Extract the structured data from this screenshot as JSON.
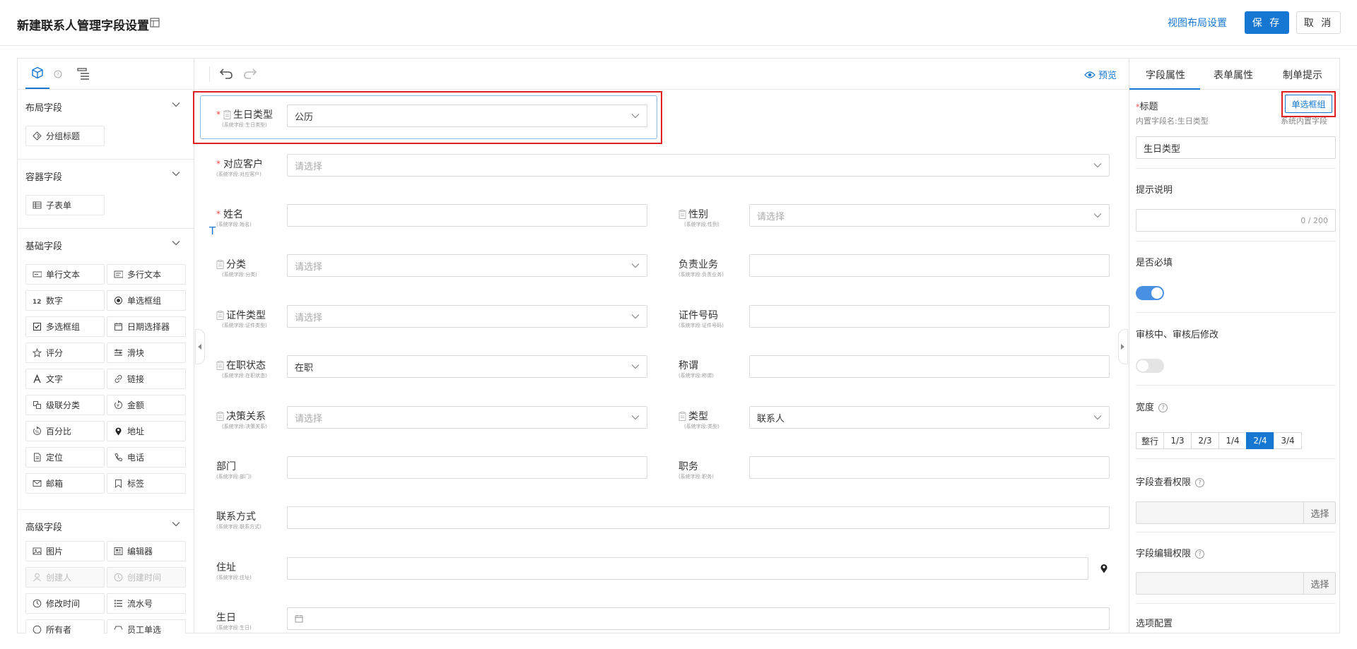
{
  "header": {
    "title": "新建联系人管理字段设置",
    "view_layout": "视图布局设置",
    "save": "保 存",
    "cancel": "取 消"
  },
  "left_panel": {
    "sections": [
      {
        "title": "布局字段",
        "items": [
          {
            "label": "分组标题",
            "icon": "group-title-icon"
          }
        ]
      },
      {
        "title": "容器字段",
        "items": [
          {
            "label": "子表单",
            "icon": "table-icon"
          }
        ]
      },
      {
        "title": "基础字段",
        "items": [
          {
            "label": "单行文本",
            "icon": "single-line-icon"
          },
          {
            "label": "多行文本",
            "icon": "multi-line-icon"
          },
          {
            "label": "数字",
            "icon": "number-icon"
          },
          {
            "label": "单选框组",
            "icon": "radio-icon"
          },
          {
            "label": "多选框组",
            "icon": "checkbox-icon"
          },
          {
            "label": "日期选择器",
            "icon": "calendar-icon"
          },
          {
            "label": "评分",
            "icon": "star-icon"
          },
          {
            "label": "滑块",
            "icon": "slider-icon"
          },
          {
            "label": "文字",
            "icon": "text-icon"
          },
          {
            "label": "链接",
            "icon": "link-icon"
          },
          {
            "label": "级联分类",
            "icon": "cascade-icon"
          },
          {
            "label": "金额",
            "icon": "money-icon"
          },
          {
            "label": "百分比",
            "icon": "percent-icon"
          },
          {
            "label": "地址",
            "icon": "location-icon"
          },
          {
            "label": "定位",
            "icon": "document-icon"
          },
          {
            "label": "电话",
            "icon": "phone-icon"
          },
          {
            "label": "邮箱",
            "icon": "mail-icon"
          },
          {
            "label": "标签",
            "icon": "tag-icon"
          }
        ]
      },
      {
        "title": "高级字段",
        "items": [
          {
            "label": "图片",
            "icon": "image-icon",
            "disabled": false
          },
          {
            "label": "编辑器",
            "icon": "editor-icon",
            "disabled": false
          },
          {
            "label": "创建人",
            "icon": "user-icon",
            "disabled": true
          },
          {
            "label": "创建时间",
            "icon": "clock-icon",
            "disabled": true
          },
          {
            "label": "修改时间",
            "icon": "clock-icon",
            "disabled": false
          },
          {
            "label": "流水号",
            "icon": "serial-icon",
            "disabled": false
          },
          {
            "label": "所有者",
            "icon": "owner-icon",
            "disabled": false
          },
          {
            "label": "员工单选",
            "icon": "employee-icon",
            "disabled": false
          }
        ]
      }
    ]
  },
  "canvas": {
    "preview": "预览",
    "fields": {
      "birthday_type": {
        "label": "生日类型",
        "sub": "(系统字段:生日类型)",
        "value": "公历"
      },
      "customer": {
        "label": "对应客户",
        "sub": "(系统字段:对应客户)",
        "placeholder": "请选择"
      },
      "name": {
        "label": "姓名",
        "sub": "(系统字段:姓名)"
      },
      "gender": {
        "label": "性别",
        "sub": "(系统字段:性别)",
        "placeholder": "请选择"
      },
      "category": {
        "label": "分类",
        "sub": "(系统字段:分类)",
        "placeholder": "请选择"
      },
      "business": {
        "label": "负责业务",
        "sub": "(系统字段:负责业务)"
      },
      "id_type": {
        "label": "证件类型",
        "sub": "(系统字段:证件类型)",
        "placeholder": "请选择"
      },
      "id_number": {
        "label": "证件号码",
        "sub": "(系统字段:证件号码)"
      },
      "status": {
        "label": "在职状态",
        "sub": "(系统字段:在职状态)",
        "value": "在职"
      },
      "title": {
        "label": "称谓",
        "sub": "(系统字段:称谓)"
      },
      "decision": {
        "label": "决策关系",
        "sub": "(系统字段:决策关系)",
        "placeholder": "请选择"
      },
      "type": {
        "label": "类型",
        "sub": "(系统字段:类型)",
        "value": "联系人"
      },
      "dept": {
        "label": "部门",
        "sub": "(系统字段:部门)"
      },
      "position": {
        "label": "职务",
        "sub": "(系统字段:职务)"
      },
      "contact": {
        "label": "联系方式",
        "sub": "(系统字段:联系方式)"
      },
      "address": {
        "label": "住址",
        "sub": "(系统字段:住址)"
      },
      "birthday": {
        "label": "生日",
        "sub": "(系统字段:生日)"
      }
    },
    "text_marker": "T"
  },
  "right_panel": {
    "tabs": [
      "字段属性",
      "表单属性",
      "制单提示"
    ],
    "active_tab": 0,
    "title_label": "标题",
    "badge": "单选框组",
    "builtin_name": "内置字段名:生日类型",
    "system_builtin": "系统内置字段",
    "title_value": "生日类型",
    "hint_label": "提示说明",
    "hint_count": "0 / 200",
    "required_label": "是否必填",
    "required_on": true,
    "audit_label": "审核中、审核后修改",
    "audit_on": false,
    "width_label": "宽度",
    "width_options": [
      "整行",
      "1/3",
      "2/3",
      "1/4",
      "2/4",
      "3/4"
    ],
    "width_selected": "2/4",
    "view_perm_label": "字段查看权限",
    "edit_perm_label": "字段编辑权限",
    "select_btn": "选择",
    "options_label": "选项配置"
  },
  "colors": {
    "accent": "#1677d2",
    "highlight": "#e02020",
    "required": "#e44444"
  }
}
